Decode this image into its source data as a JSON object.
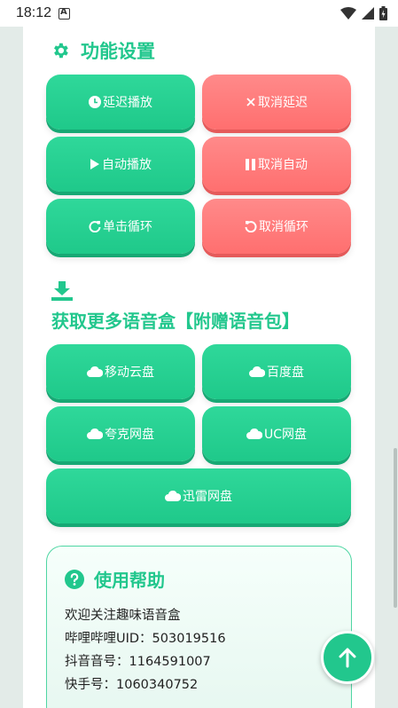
{
  "status_bar": {
    "time": "18:12"
  },
  "settings": {
    "title": "功能设置",
    "buttons": [
      {
        "label": "延迟播放",
        "icon": "clock-icon"
      },
      {
        "label": "取消延迟",
        "icon": "x-icon"
      },
      {
        "label": "自动播放",
        "icon": "play-icon"
      },
      {
        "label": "取消自动",
        "icon": "pause-icon"
      },
      {
        "label": "单击循环",
        "icon": "redo-icon"
      },
      {
        "label": "取消循环",
        "icon": "undo-icon"
      }
    ]
  },
  "download": {
    "title": "获取更多语音盒【附赠语音包】",
    "buttons": [
      {
        "label": "移动云盘",
        "icon": "cloud-icon"
      },
      {
        "label": "百度盘",
        "icon": "cloud-icon"
      },
      {
        "label": "夸克网盘",
        "icon": "cloud-icon"
      },
      {
        "label": "UC网盘",
        "icon": "cloud-icon"
      },
      {
        "label": "迅雷网盘",
        "icon": "cloud-icon"
      }
    ]
  },
  "help": {
    "title": "使用帮助",
    "lines": [
      "欢迎关注趣味语音盒",
      "哔哩哔哩UID：503019516",
      "抖音音号：1164591007",
      "快手号：1060340752"
    ]
  },
  "colors": {
    "primary": "#22c78d",
    "danger": "#ff7575"
  }
}
